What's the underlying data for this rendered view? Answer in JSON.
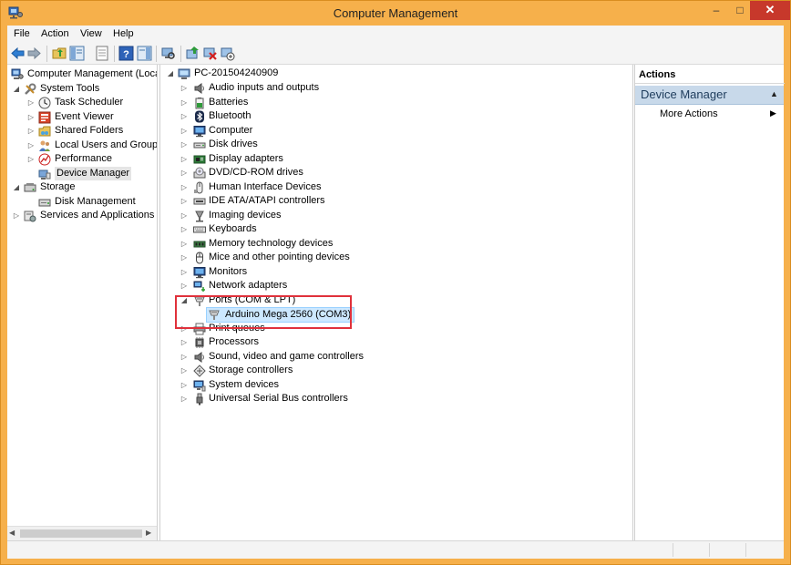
{
  "window": {
    "title": "Computer Management",
    "controls": {
      "minimize": "–",
      "maximize": "□",
      "close": "✕"
    }
  },
  "menu": [
    "File",
    "Action",
    "View",
    "Help"
  ],
  "toolbar": {
    "buttons": [
      "back-icon",
      "forward-icon",
      "up-folder-icon",
      "show-hide-tree-icon",
      "properties-icon",
      "help-icon",
      "show-hide-action-pane-icon",
      "scan-hardware-icon",
      "update-driver-icon",
      "uninstall-icon",
      "enable-device-icon"
    ]
  },
  "left_tree": [
    {
      "label": "Computer Management (Local",
      "level": 0,
      "arrow": "",
      "icon": "computer-management-icon"
    },
    {
      "label": "System Tools",
      "level": 1,
      "arrow": "◢",
      "icon": "tools-icon"
    },
    {
      "label": "Task Scheduler",
      "level": 2,
      "arrow": "▷",
      "icon": "clock-icon"
    },
    {
      "label": "Event Viewer",
      "level": 2,
      "arrow": "▷",
      "icon": "event-viewer-icon"
    },
    {
      "label": "Shared Folders",
      "level": 2,
      "arrow": "▷",
      "icon": "shared-folder-icon"
    },
    {
      "label": "Local Users and Groups",
      "level": 2,
      "arrow": "▷",
      "icon": "users-icon"
    },
    {
      "label": "Performance",
      "level": 2,
      "arrow": "▷",
      "icon": "performance-icon"
    },
    {
      "label": "Device Manager",
      "level": 2,
      "arrow": "",
      "icon": "device-manager-icon",
      "selected": true
    },
    {
      "label": "Storage",
      "level": 1,
      "arrow": "◢",
      "icon": "storage-icon"
    },
    {
      "label": "Disk Management",
      "level": 2,
      "arrow": "",
      "icon": "disk-icon"
    },
    {
      "label": "Services and Applications",
      "level": 1,
      "arrow": "▷",
      "icon": "services-icon"
    }
  ],
  "device_tree": {
    "root": "PC-201504240909",
    "items": [
      {
        "label": "Audio inputs and outputs",
        "icon": "speaker-icon"
      },
      {
        "label": "Batteries",
        "icon": "battery-icon"
      },
      {
        "label": "Bluetooth",
        "icon": "bluetooth-icon"
      },
      {
        "label": "Computer",
        "icon": "monitor-icon"
      },
      {
        "label": "Disk drives",
        "icon": "disk-drive-icon"
      },
      {
        "label": "Display adapters",
        "icon": "display-adapter-icon"
      },
      {
        "label": "DVD/CD-ROM drives",
        "icon": "dvd-icon"
      },
      {
        "label": "Human Interface Devices",
        "icon": "hid-icon"
      },
      {
        "label": "IDE ATA/ATAPI controllers",
        "icon": "ide-icon"
      },
      {
        "label": "Imaging devices",
        "icon": "camera-icon"
      },
      {
        "label": "Keyboards",
        "icon": "keyboard-icon"
      },
      {
        "label": "Memory technology devices",
        "icon": "memory-icon"
      },
      {
        "label": "Mice and other pointing devices",
        "icon": "mouse-icon"
      },
      {
        "label": "Monitors",
        "icon": "monitor-icon"
      },
      {
        "label": "Network adapters",
        "icon": "network-icon"
      },
      {
        "label": "Ports (COM & LPT)",
        "icon": "port-icon",
        "expanded": true
      },
      {
        "label": "Arduino Mega 2560 (COM3)",
        "icon": "port-icon",
        "child": true,
        "selected": true
      },
      {
        "label": "Print queues",
        "icon": "printer-icon"
      },
      {
        "label": "Processors",
        "icon": "processor-icon"
      },
      {
        "label": "Sound, video and game controllers",
        "icon": "speaker-icon"
      },
      {
        "label": "Storage controllers",
        "icon": "storage-controller-icon"
      },
      {
        "label": "System devices",
        "icon": "system-device-icon"
      },
      {
        "label": "Universal Serial Bus controllers",
        "icon": "usb-icon"
      }
    ]
  },
  "actions": {
    "header": "Actions",
    "section": "Device Manager",
    "more_actions": "More Actions"
  },
  "colors": {
    "frame": "#f6b04b",
    "close_button": "#c7382b",
    "selection": "#cce8ff",
    "highlight_box": "#e0313b",
    "actions_section": "#c8d9ea"
  }
}
